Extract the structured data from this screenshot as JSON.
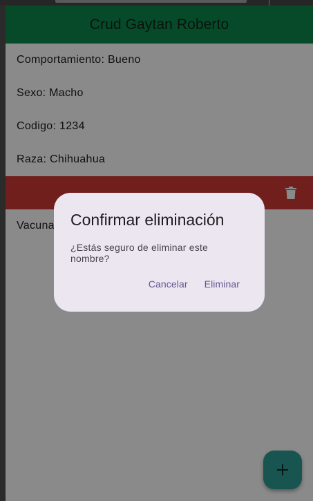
{
  "app_bar": {
    "title": "Crud Gaytan Roberto"
  },
  "details": [
    {
      "label": "Comportamiento: Bueno"
    },
    {
      "label": "Sexo: Macho"
    },
    {
      "label": "Codigo: 1234"
    },
    {
      "label": "Raza: Chihuahua"
    }
  ],
  "vacuna_item": {
    "label": "Vacuna"
  },
  "swipe_background": {
    "icon": "trash-icon",
    "color": "#d03a36"
  },
  "dialog": {
    "title": "Confirmar eliminación",
    "message": "¿Estás seguro de eliminar este nombre?",
    "cancel_label": "Cancelar",
    "confirm_label": "Eliminar"
  },
  "fab": {
    "icon": "plus-icon"
  },
  "colors": {
    "app_bar": "#0d8a4f",
    "accent": "#65558f",
    "fab": "#2e9e94"
  }
}
